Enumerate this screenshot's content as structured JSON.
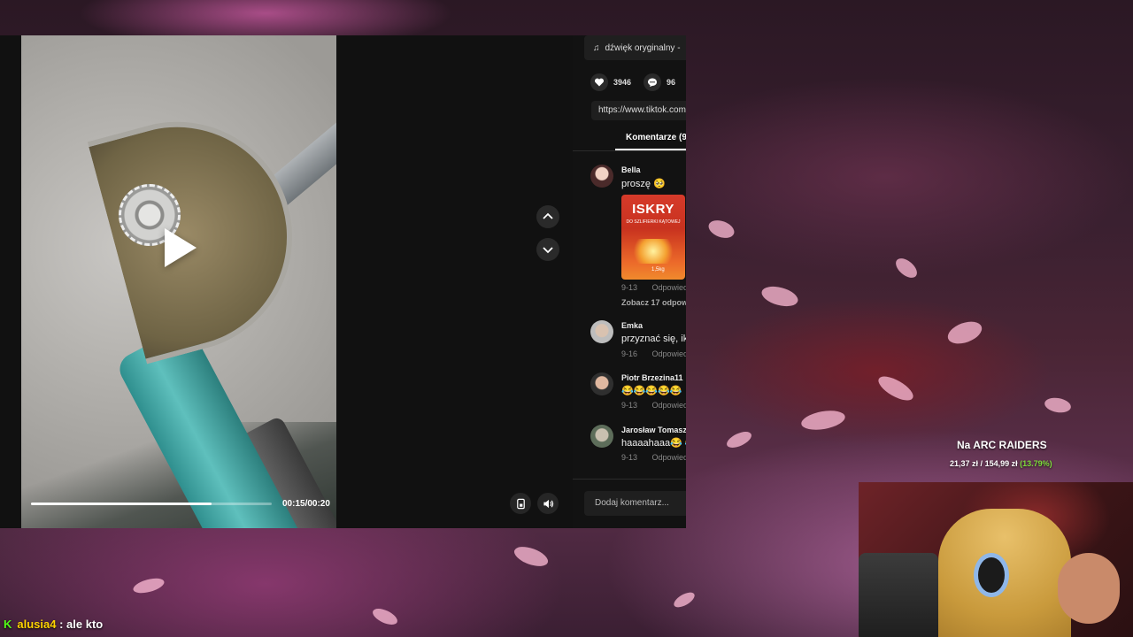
{
  "player": {
    "time": "00:15/00:20",
    "progress": 0.75
  },
  "sidebar": {
    "sound_label": "dźwięk oryginalny -",
    "likes": "3946",
    "comments_count": "96",
    "url": "https://www.tiktok.com",
    "comments_tab": "Komentarze (9",
    "see_replies": "Zobacz 17 odpow",
    "add_comment_placeholder": "Dodaj komentarz..."
  },
  "comments": [
    {
      "user": "Bella",
      "text": "proszę 🥺",
      "date": "9-13",
      "reply": "Odpowied",
      "sticker": {
        "brand": "ISKRY",
        "sub": "DO SZLIFIERKI KĄTOWEJ",
        "weight": "1,5kg"
      }
    },
    {
      "user": "Emka",
      "text": "przyznać się, ik",
      "date": "9-16",
      "reply": "Odpowied"
    },
    {
      "user": "Piotr Brzezina11",
      "text": "😂😂😂😂😂",
      "date": "9-13",
      "reply": "Odpowied"
    },
    {
      "user": "Jarosław Tomasz",
      "text": "haaaahaaa😂 😂",
      "date": "9-13",
      "reply": "Odpowied"
    }
  ],
  "overlay": {
    "goal_title": "Na ARC RAIDERS",
    "goal_current": "21,37 zł",
    "goal_target": "154,99 zł",
    "goal_percent": "(13.79%)"
  },
  "chat": {
    "platform_icon": "kick-logo",
    "username": "alusia4",
    "separator": " : ",
    "message": "ale kto"
  },
  "colors": {
    "panel_bg": "#111111",
    "goal_percent": "#7ddc3b",
    "chat_username": "#ffd400",
    "kick_green": "#53fc18"
  }
}
